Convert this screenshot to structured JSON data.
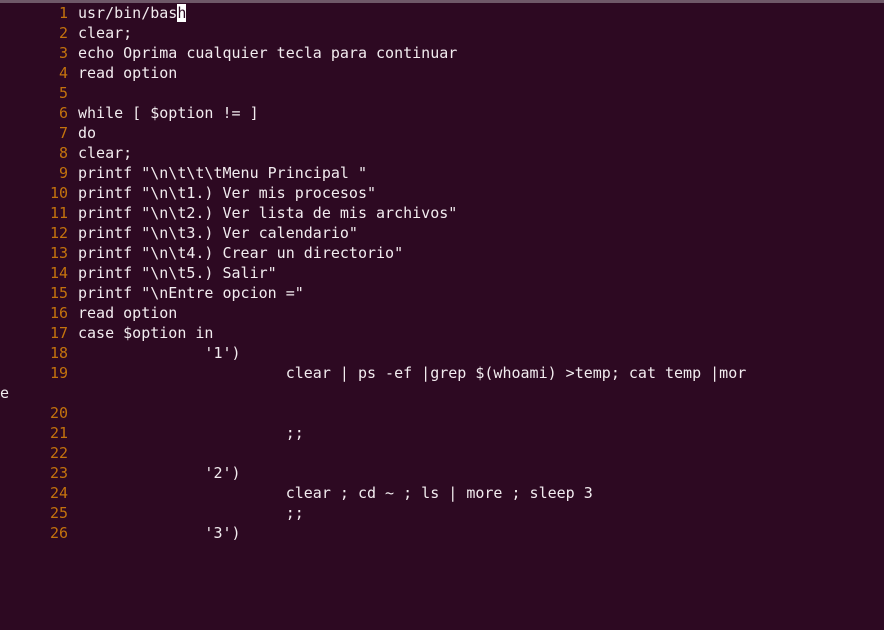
{
  "editor": {
    "title": "bash script editor",
    "colors": {
      "background": "#2d0922",
      "line_number": "#c4730d",
      "text": "#f2ecef",
      "cursor_bg": "#ffffff",
      "top_strip": "#6e5868"
    },
    "cursor": {
      "line": 1,
      "column": 14,
      "char_under": "h"
    },
    "lines": [
      {
        "num": "1",
        "text": "usr/bin/bas",
        "cursor_char": "h",
        "tail": ""
      },
      {
        "num": "2",
        "text": "clear;"
      },
      {
        "num": "3",
        "text": "echo Oprima cualquier tecla para continuar"
      },
      {
        "num": "4",
        "text": "read option"
      },
      {
        "num": "5",
        "text": ""
      },
      {
        "num": "6",
        "text": "while [ $option != ]"
      },
      {
        "num": "7",
        "text": "do"
      },
      {
        "num": "8",
        "text": "clear;"
      },
      {
        "num": "9",
        "text": "printf \"\\n\\t\\t\\tMenu Principal \""
      },
      {
        "num": "10",
        "text": "printf \"\\n\\t1.) Ver mis procesos\""
      },
      {
        "num": "11",
        "text": "printf \"\\n\\t2.) Ver lista de mis archivos\""
      },
      {
        "num": "12",
        "text": "printf \"\\n\\t3.) Ver calendario\""
      },
      {
        "num": "13",
        "text": "printf \"\\n\\t4.) Crear un directorio\""
      },
      {
        "num": "14",
        "text": "printf \"\\n\\t5.) Salir\""
      },
      {
        "num": "15",
        "text": "printf \"\\nEntre opcion =\""
      },
      {
        "num": "16",
        "text": "read option"
      },
      {
        "num": "17",
        "text": "case $option in"
      },
      {
        "num": "18",
        "text": "              '1')"
      },
      {
        "num": "19",
        "text": "                       clear | ps -ef |grep $(whoami) >temp; cat temp |mor"
      },
      {
        "num": "",
        "text": "e",
        "wrapped": true
      },
      {
        "num": "20",
        "text": ""
      },
      {
        "num": "21",
        "text": "                       ;;"
      },
      {
        "num": "22",
        "text": ""
      },
      {
        "num": "23",
        "text": "              '2')"
      },
      {
        "num": "24",
        "text": "                       clear ; cd ~ ; ls | more ; sleep 3"
      },
      {
        "num": "25",
        "text": "                       ;;"
      },
      {
        "num": "26",
        "text": "              '3')"
      }
    ]
  }
}
